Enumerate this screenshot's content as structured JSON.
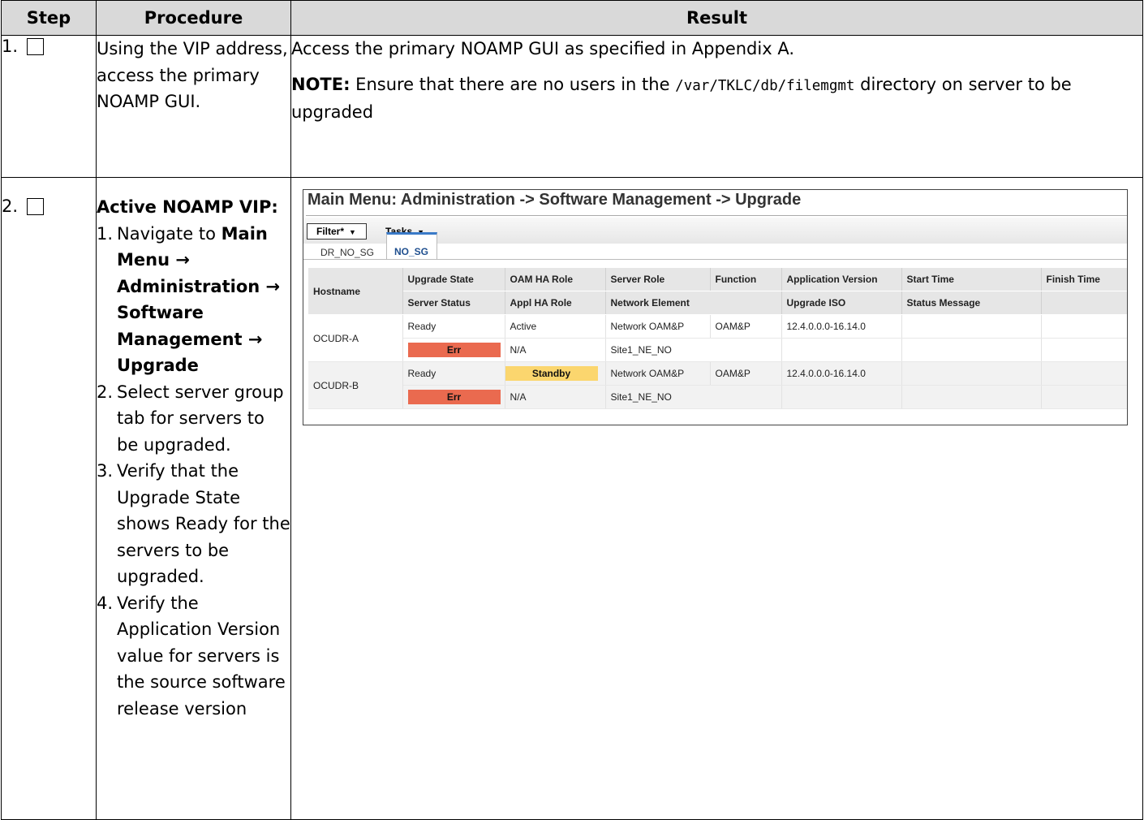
{
  "headers": {
    "step": "Step",
    "procedure": "Procedure",
    "result": "Result"
  },
  "row1": {
    "step": "1.",
    "procedure": "Using the VIP address, access the primary NOAMP GUI.",
    "result_line1": "Access the primary NOAMP GUI as specified in Appendix A.",
    "note_label": "NOTE:",
    "note_pre": " Ensure that there are no users in the ",
    "note_path": "/var/TKLC/db/filemgmt",
    "note_post": " directory on server to be upgraded"
  },
  "row2": {
    "step": "2.",
    "title": "Active NOAMP VIP:",
    "items": [
      {
        "n": "1.",
        "t": "Navigate to "
      },
      {
        "n": "2.",
        "t": "Select server group tab for servers to be upgraded."
      },
      {
        "n": "3.",
        "t": "Verify that the Upgrade State shows Ready for the servers to be upgraded."
      },
      {
        "n": "4.",
        "t": "Verify the Application Version value for servers is the source software release version"
      }
    ],
    "nav": {
      "main_menu": "Main Menu",
      "administration": "Administration",
      "software_management": "Software Management",
      "upgrade": "Upgrade",
      "arrow": "→"
    }
  },
  "screenshot": {
    "title": "Main Menu: Administration -> Software Management -> Upgrade",
    "filter_label": "Filter*",
    "tasks_label": "Tasks",
    "tabs": [
      "DR_NO_SG",
      "NO_SG"
    ],
    "header_row1": [
      "Hostname",
      "Upgrade State",
      "OAM HA Role",
      "Server Role",
      "Function",
      "Application Version",
      "Start Time",
      "Finish Time"
    ],
    "header_row2": [
      "Server Status",
      "Appl HA Role",
      "Network Element",
      "",
      "Upgrade ISO",
      "Status Message",
      ""
    ],
    "servers": [
      {
        "hostname": "OCUDR-A",
        "upgrade_state": "Ready",
        "oam_ha_role": "Active",
        "server_role": "Network OAM&P",
        "function": "OAM&P",
        "app_version": "12.4.0.0.0-16.14.0",
        "server_status": "Err",
        "appl_ha_role": "N/A",
        "network_element": "Site1_NE_NO"
      },
      {
        "hostname": "OCUDR-B",
        "upgrade_state": "Ready",
        "oam_ha_role": "Standby",
        "server_role": "Network OAM&P",
        "function": "OAM&P",
        "app_version": "12.4.0.0.0-16.14.0",
        "server_status": "Err",
        "appl_ha_role": "N/A",
        "network_element": "Site1_NE_NO"
      }
    ],
    "colors": {
      "error": "#ea6a4f",
      "standby": "#fbd66e",
      "ready": "#2a8a2a",
      "na": "#2a2acc"
    }
  }
}
